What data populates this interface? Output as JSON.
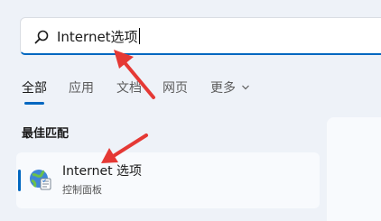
{
  "search": {
    "value": "Internet选项",
    "accent_color": "#0067c0"
  },
  "tabs": [
    {
      "label": "全部",
      "active": true
    },
    {
      "label": "应用",
      "active": false
    },
    {
      "label": "文档",
      "active": false
    },
    {
      "label": "网页",
      "active": false
    },
    {
      "label": "更多",
      "active": false
    }
  ],
  "best_match": {
    "section_title": "最佳匹配",
    "result": {
      "title": "Internet 选项",
      "subtitle": "控制面板",
      "icon": "internet-options-icon"
    }
  },
  "annotations": {
    "arrow_color": "#e53935"
  }
}
